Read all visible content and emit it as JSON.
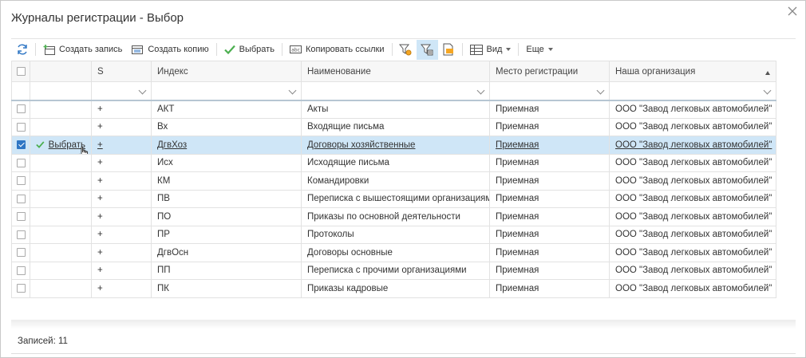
{
  "dialog": {
    "title": "Журналы регистрации - Выбор"
  },
  "toolbar": {
    "create_record": "Создать запись",
    "create_copy": "Создать копию",
    "select": "Выбрать",
    "copy_links": "Копировать ссылки",
    "view": "Вид",
    "more": "Еще"
  },
  "columns": {
    "s": "S",
    "index": "Индекс",
    "name": "Наименование",
    "place": "Место регистрации",
    "org": "Наша организация"
  },
  "row_action": "Выбрать",
  "rows": [
    {
      "s": "+",
      "index": "АКТ",
      "name": "Акты",
      "place": "Приемная",
      "org": "ООО \"Завод легковых автомобилей\""
    },
    {
      "s": "+",
      "index": "Вх",
      "name": "Входящие письма",
      "place": "Приемная",
      "org": "ООО \"Завод легковых автомобилей\""
    },
    {
      "s": "+",
      "index": "ДгвХоз",
      "name": "Договоры хозяйственные",
      "place": "Приемная",
      "org": "ООО \"Завод легковых автомобилей\""
    },
    {
      "s": "+",
      "index": "Исх",
      "name": "Исходящие письма",
      "place": "Приемная",
      "org": "ООО \"Завод легковых автомобилей\""
    },
    {
      "s": "+",
      "index": "КМ",
      "name": "Командировки",
      "place": "Приемная",
      "org": "ООО \"Завод легковых автомобилей\""
    },
    {
      "s": "+",
      "index": "ПВ",
      "name": "Переписка с вышестоящими организациями",
      "place": "Приемная",
      "org": "ООО \"Завод легковых автомобилей\""
    },
    {
      "s": "+",
      "index": "ПО",
      "name": "Приказы по основной деятельности",
      "place": "Приемная",
      "org": "ООО \"Завод легковых автомобилей\""
    },
    {
      "s": "+",
      "index": "ПР",
      "name": "Протоколы",
      "place": "Приемная",
      "org": "ООО \"Завод легковых автомобилей\""
    },
    {
      "s": "+",
      "index": "ДгвОсн",
      "name": "Договоры основные",
      "place": "Приемная",
      "org": "ООО \"Завод легковых автомобилей\""
    },
    {
      "s": "+",
      "index": "ПП",
      "name": "Переписка с прочими организациями",
      "place": "Приемная",
      "org": "ООО \"Завод легковых автомобилей\""
    },
    {
      "s": "+",
      "index": "ПК",
      "name": "Приказы кадровые",
      "place": "Приемная",
      "org": "ООО \"Завод легковых автомобилей\""
    }
  ],
  "footer": {
    "records": "Записей: 11"
  },
  "colors": {
    "accent": "#2f76c4",
    "selected_row": "#cfe6f7",
    "check_green": "#4caf50"
  }
}
